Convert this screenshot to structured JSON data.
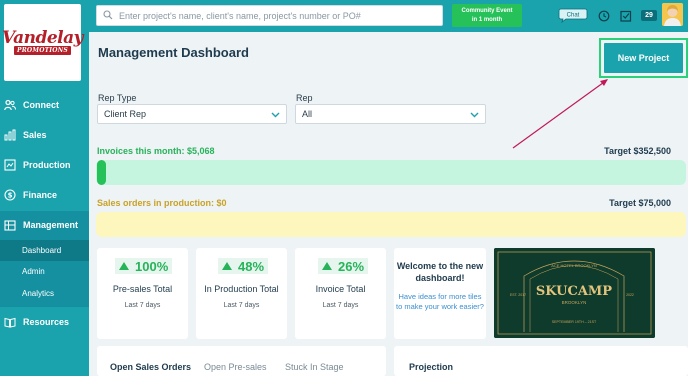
{
  "brand": {
    "logo_word": "Vandelay",
    "logo_sub": "PROMOTIONS",
    "accent": "#1aa3ad",
    "logo_red": "#b4202a"
  },
  "sidebar": {
    "items": [
      {
        "label": "Connect",
        "icon": "people-icon"
      },
      {
        "label": "Sales",
        "icon": "bar-chart-icon"
      },
      {
        "label": "Production",
        "icon": "production-icon"
      },
      {
        "label": "Finance",
        "icon": "dollar-icon"
      },
      {
        "label": "Management",
        "icon": "management-icon"
      },
      {
        "label": "Resources",
        "icon": "book-icon"
      }
    ],
    "management_sub": [
      "Dashboard",
      "Admin",
      "Analytics"
    ]
  },
  "topbar": {
    "search_placeholder": "Enter project's name, client's name, project's number or PO#",
    "event_button_line1": "Community Event",
    "event_button_line2": "in 1 month",
    "chat_label": "Chat",
    "badge_count": "29"
  },
  "main": {
    "title": "Management Dashboard",
    "new_project_label": "New Project",
    "filters": {
      "rep_type_label": "Rep Type",
      "rep_type_value": "Client Rep",
      "rep_label": "Rep",
      "rep_value": "All"
    },
    "invoices": {
      "label": "Invoices this month: $5,068",
      "target": "Target $352,500",
      "progress": 0.014,
      "color": "#27c15a"
    },
    "sales_orders": {
      "label": "Sales orders in production: $0",
      "target": "Target $75,000",
      "progress": 0,
      "color": "#c9a227"
    },
    "cards": [
      {
        "pct": "100%",
        "title": "Pre-sales Total",
        "sub": "Last 7 days"
      },
      {
        "pct": "48%",
        "title": "In Production Total",
        "sub": "Last 7 days"
      },
      {
        "pct": "26%",
        "title": "Invoice Total",
        "sub": "Last 7 days"
      }
    ],
    "welcome": {
      "title": "Welcome to the new dashboard!",
      "link": "Have ideas for more tiles to make your work easier?"
    },
    "promo": {
      "top": "ACE HOTEL BROOKLYN",
      "main": "SKUCAMP",
      "sub": "BROOKLYN",
      "left": "EST. 2017",
      "right": "2022",
      "date": "SEPTEMBER 19TH – 21ST"
    },
    "tabs": [
      "Open Sales Orders",
      "Open Pre-sales",
      "Stuck In Stage"
    ],
    "projection_label": "Projection"
  }
}
